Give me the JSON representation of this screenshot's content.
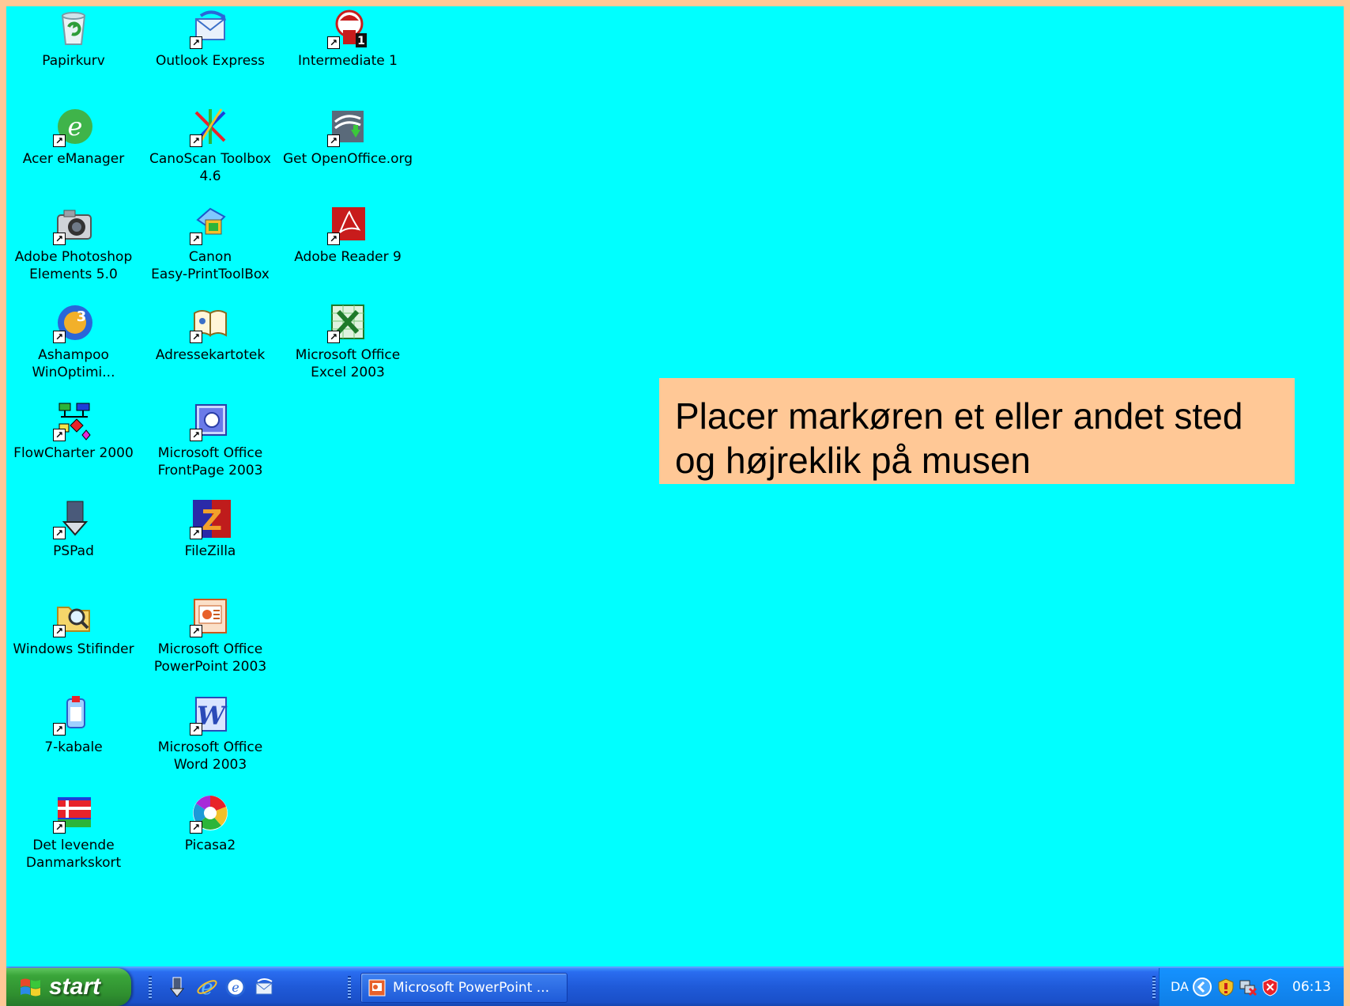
{
  "desktop": {
    "background_color": "#00ffff",
    "icons": [
      {
        "label": "Papirkurv",
        "icon": "recycle-bin-icon"
      },
      {
        "label": "Acer eManager",
        "icon": "acer-emanager-icon"
      },
      {
        "label": "Adobe Photoshop\nElements 5.0",
        "icon": "camera-icon"
      },
      {
        "label": "Ashampoo\nWinOptimi...",
        "icon": "ashampoo-icon"
      },
      {
        "label": "FlowCharter 2000",
        "icon": "flowchart-icon"
      },
      {
        "label": "PSPad",
        "icon": "pspad-icon"
      },
      {
        "label": "Windows Stifinder",
        "icon": "folder-search-icon"
      },
      {
        "label": "7-kabale",
        "icon": "solitaire-icon"
      },
      {
        "label": "Det levende\nDanmarkskort",
        "icon": "denmark-map-icon"
      },
      {
        "label": "Outlook Express",
        "icon": "outlook-express-icon"
      },
      {
        "label": "CanoScan Toolbox\n4.6",
        "icon": "canoscan-icon"
      },
      {
        "label": "Canon\nEasy-PrintToolBox",
        "icon": "canon-print-icon"
      },
      {
        "label": "Adressekartotek",
        "icon": "address-book-icon"
      },
      {
        "label": "Microsoft Office\nFrontPage 2003",
        "icon": "frontpage-icon"
      },
      {
        "label": "FileZilla",
        "icon": "filezilla-icon"
      },
      {
        "label": "Microsoft Office\nPowerPoint 2003",
        "icon": "powerpoint-icon"
      },
      {
        "label": "Microsoft Office\nWord 2003",
        "icon": "word-icon"
      },
      {
        "label": "Picasa2",
        "icon": "picasa-icon"
      },
      {
        "label": "Intermediate 1",
        "icon": "intermediate-icon"
      },
      {
        "label": "Get OpenOffice.org",
        "icon": "openoffice-icon"
      },
      {
        "label": "Adobe Reader 9",
        "icon": "adobe-reader-icon"
      },
      {
        "label": "Microsoft Office\nExcel 2003",
        "icon": "excel-icon"
      }
    ]
  },
  "callout": {
    "text": "Placer markøren et eller andet sted og højreklik på musen",
    "background": "#ffc896"
  },
  "taskbar": {
    "start_label": "start",
    "quick_launch": [
      "pspad-icon",
      "internet-explorer-icon",
      "ie-update-icon",
      "outlook-express-icon"
    ],
    "tasks": [
      {
        "label": "Microsoft PowerPoint ...",
        "icon": "powerpoint-icon"
      }
    ],
    "tray": {
      "language": "DA",
      "icons": [
        "chevron-left-icon",
        "security-shield-icon",
        "network-disconnected-icon",
        "antivirus-icon"
      ],
      "clock": "06:13"
    }
  }
}
